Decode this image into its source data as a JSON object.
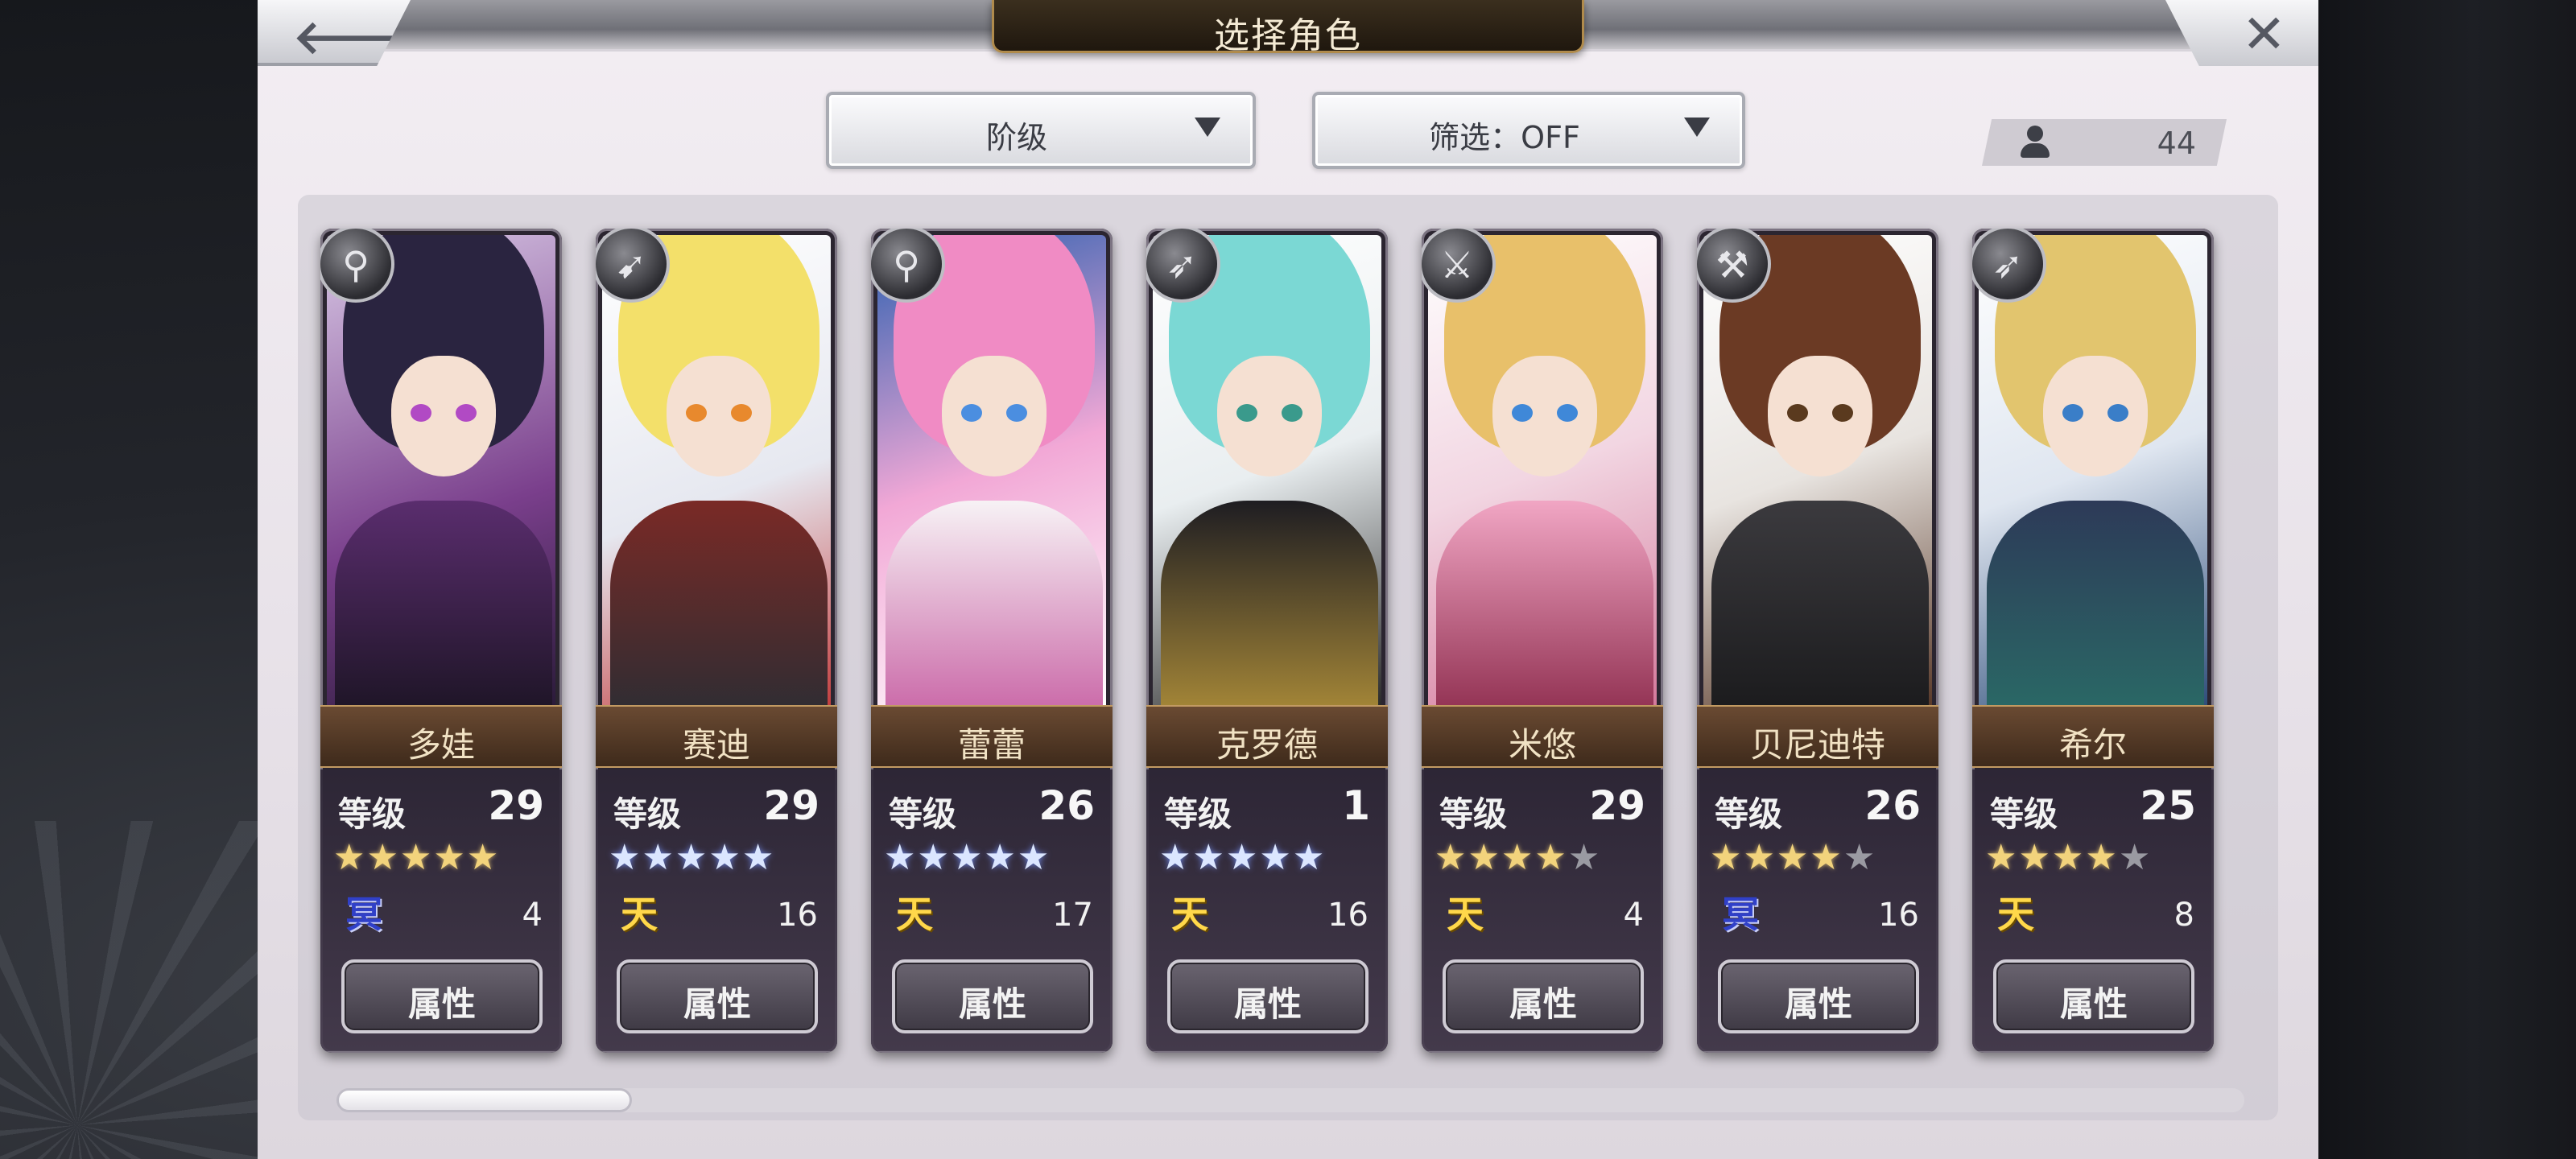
{
  "header": {
    "title": "选择角色",
    "back_icon": "arrow-left-icon",
    "close_icon": "close-x-icon"
  },
  "filters": {
    "sort_label": "阶级",
    "filter_label": "筛选：OFF"
  },
  "roster_count": "44",
  "scroll": {
    "position_fraction": 0.0,
    "visible_fraction": 0.155
  },
  "colors": {
    "gold_star": "#f2d37c",
    "blue_star": "#dbe6ff",
    "rank_gold": "#ffd84a",
    "rank_blue": "#3040c8"
  },
  "characters": [
    {
      "name": "多娃",
      "level_label": "等级",
      "level": "29",
      "stars": [
        "on",
        "on",
        "on",
        "on",
        "on"
      ],
      "rank_icon": "冥",
      "rank_type": "blue",
      "rank_value": "4",
      "attr_label": "属性",
      "weapon_icon": "staff-icon",
      "weapon_glyph": "⚲"
    },
    {
      "name": "赛迪",
      "level_label": "等级",
      "level": "29",
      "stars": [
        "blue",
        "blue",
        "blue",
        "blue",
        "blue"
      ],
      "rank_icon": "天",
      "rank_type": "gold",
      "rank_value": "16",
      "attr_label": "属性",
      "weapon_icon": "spear-icon",
      "weapon_glyph": "➹"
    },
    {
      "name": "蕾蕾",
      "level_label": "等级",
      "level": "26",
      "stars": [
        "blue",
        "blue",
        "blue",
        "blue",
        "blue"
      ],
      "rank_icon": "天",
      "rank_type": "gold",
      "rank_value": "17",
      "attr_label": "属性",
      "weapon_icon": "staff-icon",
      "weapon_glyph": "⚲"
    },
    {
      "name": "克罗德",
      "level_label": "等级",
      "level": "1",
      "stars": [
        "blue",
        "blue",
        "blue",
        "blue",
        "blue"
      ],
      "rank_icon": "天",
      "rank_type": "gold",
      "rank_value": "16",
      "attr_label": "属性",
      "weapon_icon": "bow-icon",
      "weapon_glyph": "➶"
    },
    {
      "name": "米悠",
      "level_label": "等级",
      "level": "29",
      "stars": [
        "on",
        "on",
        "on",
        "on",
        "off"
      ],
      "rank_icon": "天",
      "rank_type": "gold",
      "rank_value": "4",
      "attr_label": "属性",
      "weapon_icon": "sword-icon",
      "weapon_glyph": "⚔"
    },
    {
      "name": "贝尼迪特",
      "level_label": "等级",
      "level": "26",
      "stars": [
        "on",
        "on",
        "on",
        "on",
        "off"
      ],
      "rank_icon": "冥",
      "rank_type": "blue",
      "rank_value": "16",
      "attr_label": "属性",
      "weapon_icon": "axe-icon",
      "weapon_glyph": "⚒"
    },
    {
      "name": "希尔",
      "level_label": "等级",
      "level": "25",
      "stars": [
        "on",
        "on",
        "on",
        "on",
        "off"
      ],
      "rank_icon": "天",
      "rank_type": "gold",
      "rank_value": "8",
      "attr_label": "属性",
      "weapon_icon": "bow-icon",
      "weapon_glyph": "➶"
    }
  ]
}
